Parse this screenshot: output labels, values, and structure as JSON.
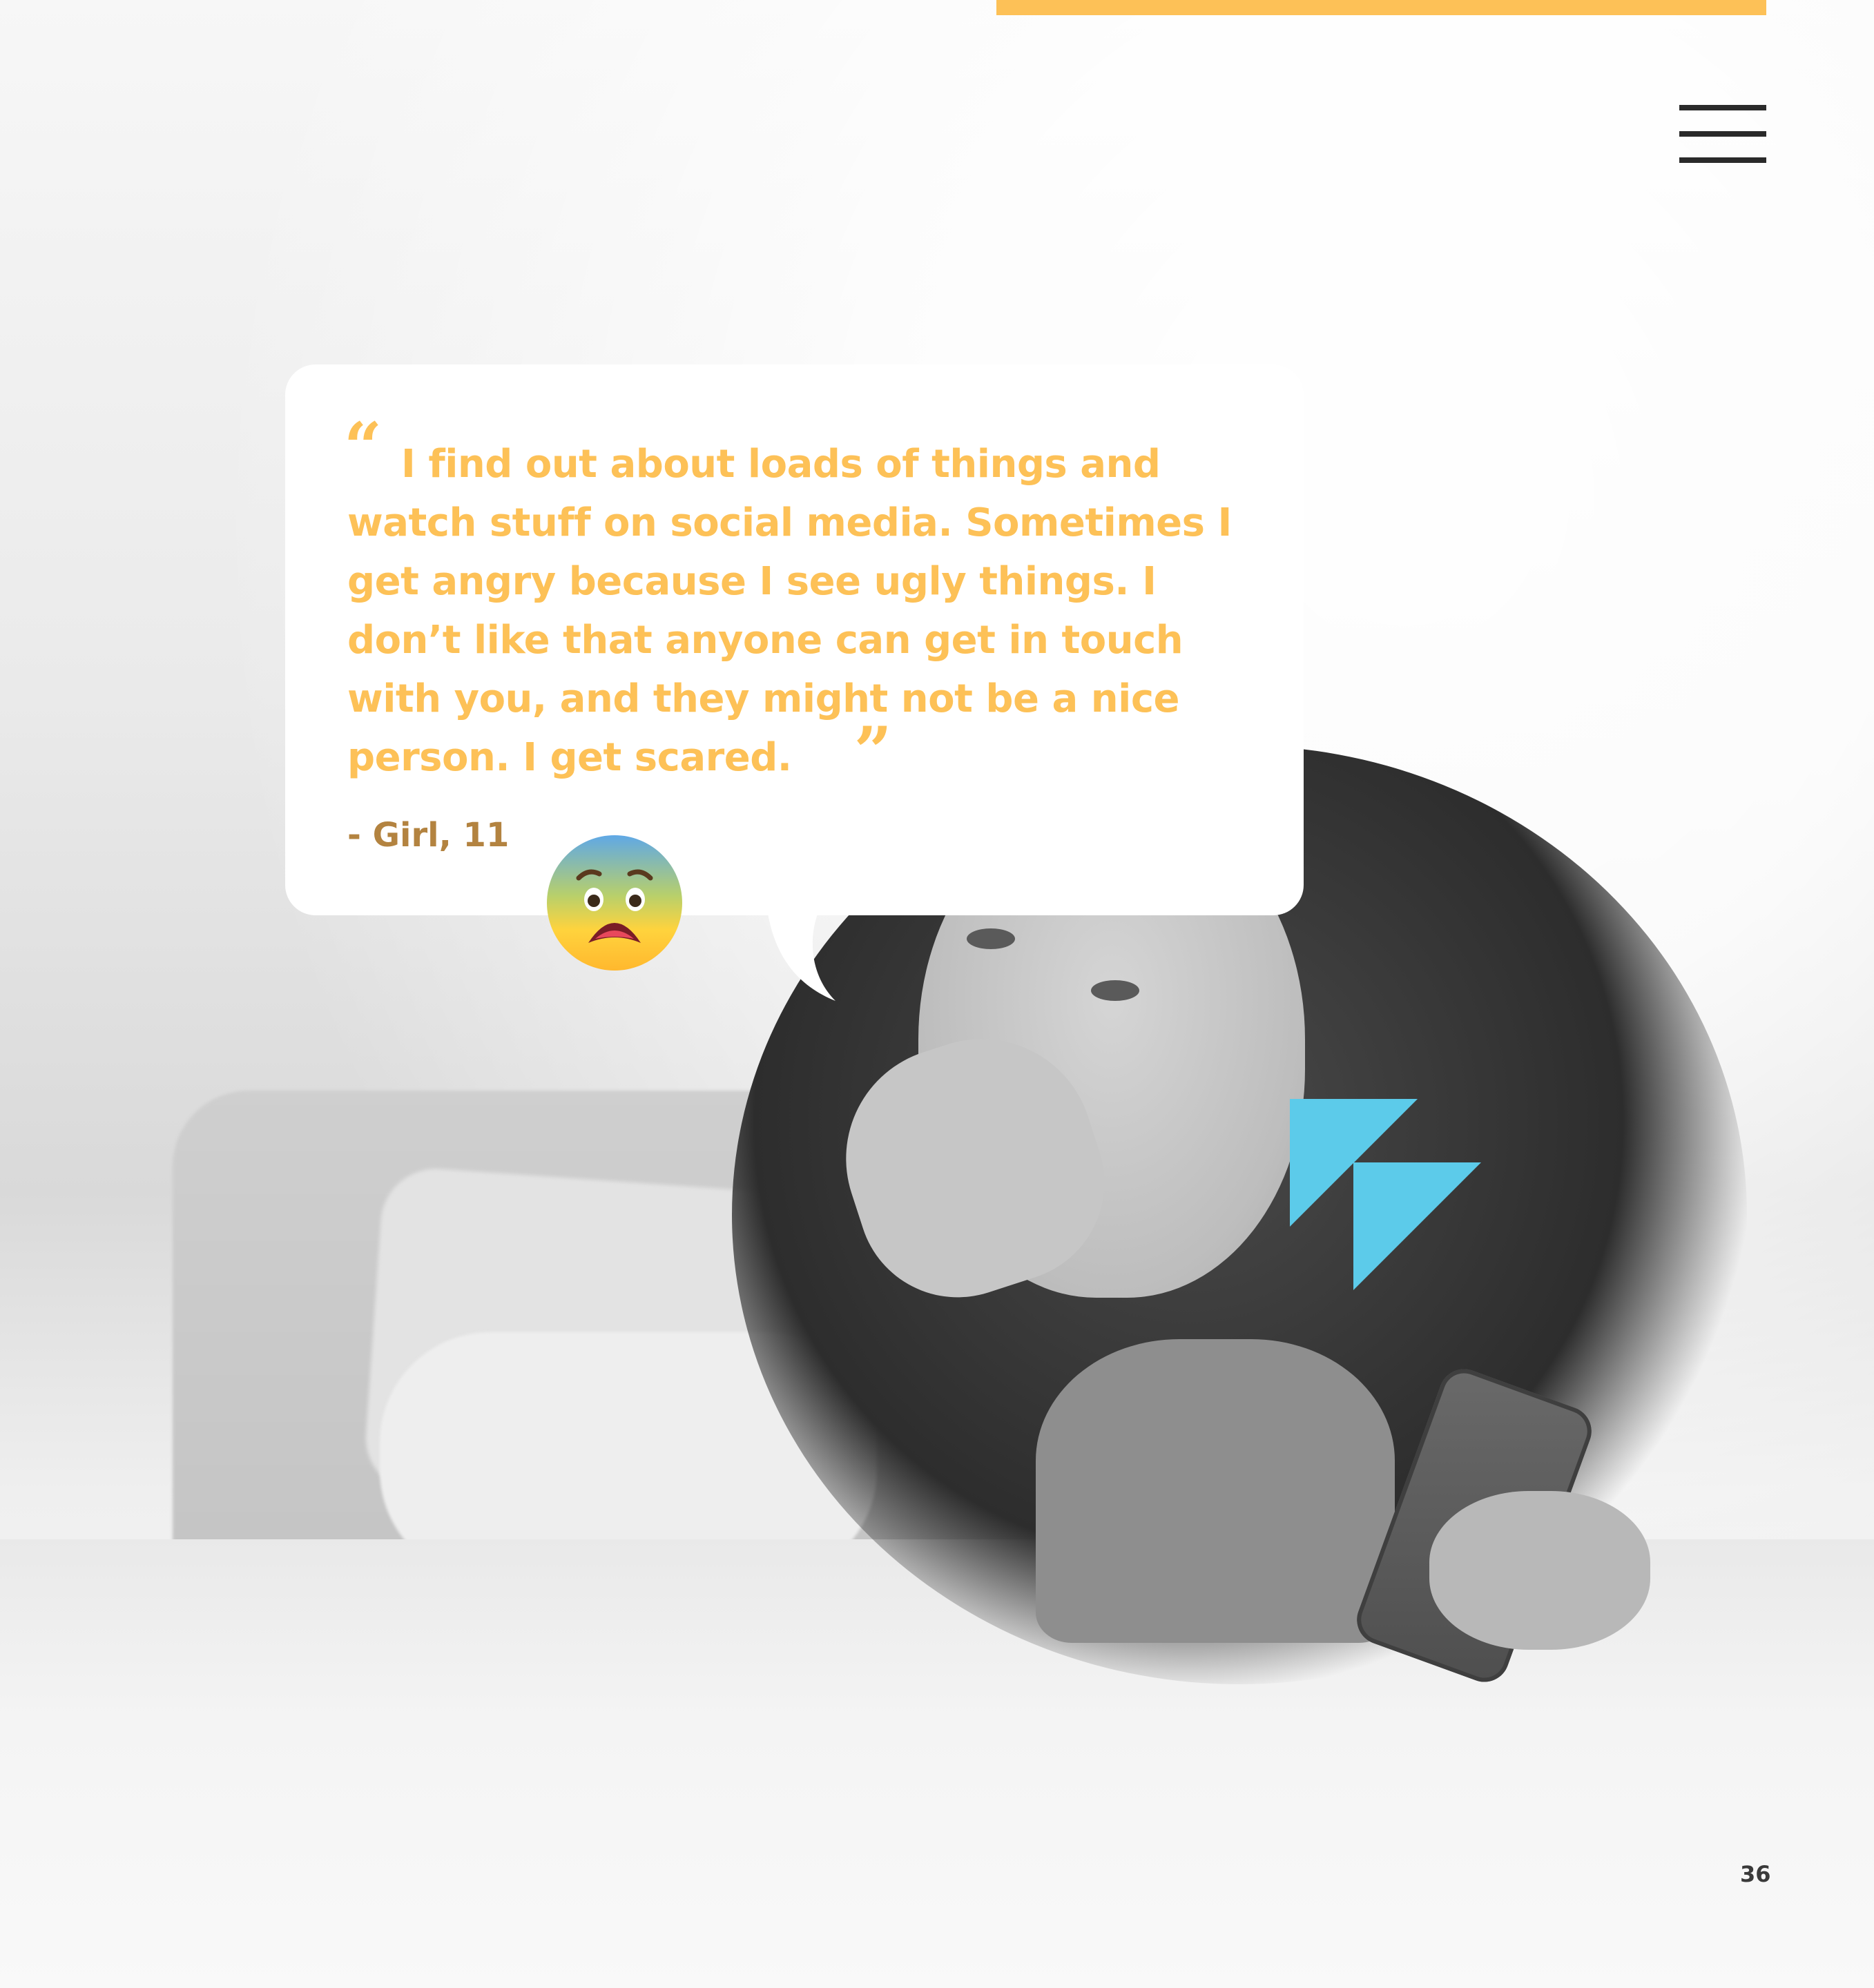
{
  "quote": {
    "open_mark": "“",
    "text": "I find out about loads of things and watch stuff on social media. Sometimes I get angry because I see ugly things. I don’t like that anyone can get in touch with you, and they might not be a nice person. I get scared.",
    "close_mark": "”",
    "attribution": "-  Girl, 11"
  },
  "emoji": {
    "icon": "anxious-face-icon"
  },
  "menu": {
    "icon": "hamburger-menu-icon"
  },
  "page": {
    "number": "36"
  },
  "colors": {
    "accent_yellow": "#fdc157",
    "attribution_brown": "#b38340",
    "triangle_blue": "#5ccbea",
    "menu_dark": "#2a2a2a"
  }
}
